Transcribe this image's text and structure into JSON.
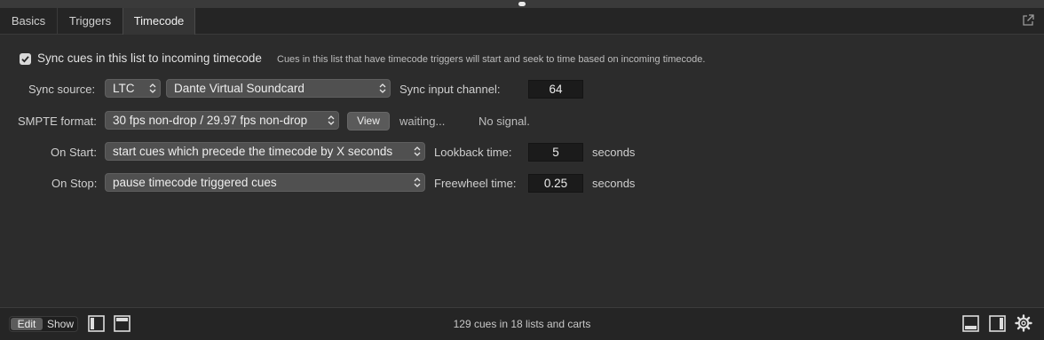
{
  "tabs": [
    {
      "label": "Basics",
      "active": false
    },
    {
      "label": "Triggers",
      "active": false
    },
    {
      "label": "Timecode",
      "active": true
    }
  ],
  "sync": {
    "checkbox_label": "Sync cues in this list to incoming timecode",
    "checked": true,
    "description": "Cues in this list that have timecode triggers will start and seek to time based on incoming timecode."
  },
  "source": {
    "label": "Sync source:",
    "type_value": "LTC",
    "device_value": "Dante Virtual Soundcard",
    "channel_label": "Sync input channel:",
    "channel_value": "64"
  },
  "smpte": {
    "label": "SMPTE format:",
    "value": "30 fps non-drop / 29.97 fps non-drop",
    "view_button": "View",
    "status_waiting": "waiting...",
    "status_signal": "No signal."
  },
  "on_start": {
    "label": "On Start:",
    "value": "start cues which precede the timecode by X seconds",
    "time_label": "Lookback time:",
    "time_value": "5",
    "unit": "seconds"
  },
  "on_stop": {
    "label": "On Stop:",
    "value": "pause timecode triggered cues",
    "time_label": "Freewheel time:",
    "time_value": "0.25",
    "unit": "seconds"
  },
  "footer": {
    "edit_label": "Edit",
    "show_label": "Show",
    "status_text": "129 cues in 18 lists and carts"
  },
  "icons": [
    "popout-icon",
    "sidebar-left-icon",
    "toolbar-top-icon",
    "panel-bottom-icon",
    "sidebar-right-icon",
    "gear-icon",
    "stepper-arrows-icon",
    "checkmark-icon"
  ]
}
